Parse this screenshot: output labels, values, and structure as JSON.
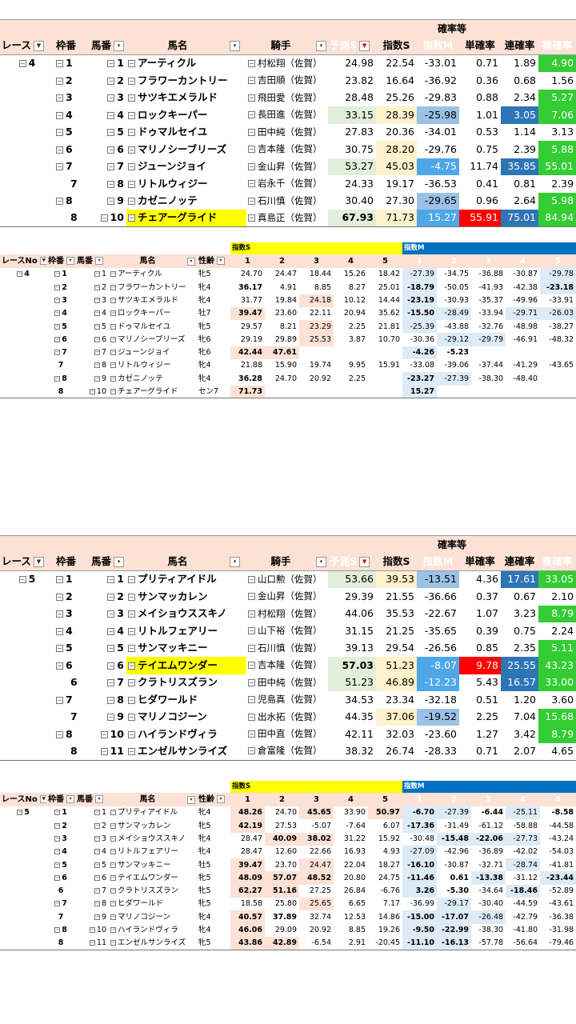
{
  "section_label": "確率等",
  "big_headers": {
    "race": "レース",
    "frame": "枠番",
    "horse_no": "馬番",
    "horse": "馬名",
    "jockey": "騎手",
    "pred": "予測S",
    "idxS": "指数S",
    "idxM": "指数M",
    "win": "単確率",
    "quin": "連確率",
    "place": "複確率"
  },
  "small_headers": {
    "groupS": "指数S",
    "groupM": "指数M",
    "race": "レースNo",
    "frame": "枠番",
    "horse_no": "馬番",
    "horse": "馬名",
    "sexage": "性齢",
    "cols": [
      "1",
      "2",
      "3",
      "4",
      "5"
    ]
  },
  "big1": [
    {
      "race": "4",
      "frame": "1",
      "no": "1",
      "name": "アーティクル",
      "jockey": "村松翔（佐賀）",
      "pred": "24.98",
      "s": "22.54",
      "m": "-33.01",
      "win": "0.71",
      "quin": "1.89",
      "place": "4.90"
    },
    {
      "race": "",
      "frame": "2",
      "no": "2",
      "name": "フラワーカントリー",
      "jockey": "吉田順（佐賀）",
      "pred": "23.82",
      "s": "16.64",
      "m": "-36.92",
      "win": "0.36",
      "quin": "0.68",
      "place": "1.56"
    },
    {
      "race": "",
      "frame": "3",
      "no": "3",
      "name": "サツキエメラルド",
      "jockey": "飛田愛（佐賀）",
      "pred": "28.48",
      "s": "25.26",
      "m": "-29.83",
      "win": "0.88",
      "quin": "2.34",
      "place": "5.27"
    },
    {
      "race": "",
      "frame": "4",
      "no": "4",
      "name": "ロックキーパー",
      "jockey": "長田進（佐賀）",
      "pred": "33.15",
      "s": "28.39",
      "m": "-25.98",
      "win": "1.01",
      "quin": "3.05",
      "place": "7.06"
    },
    {
      "race": "",
      "frame": "5",
      "no": "5",
      "name": "ドゥマルセイユ",
      "jockey": "田中純（佐賀）",
      "pred": "27.83",
      "s": "20.36",
      "m": "-34.01",
      "win": "0.53",
      "quin": "1.14",
      "place": "3.13"
    },
    {
      "race": "",
      "frame": "6",
      "no": "6",
      "name": "マリノシーブリーズ",
      "jockey": "吉本隆（佐賀）",
      "pred": "30.75",
      "s": "28.20",
      "m": "-29.76",
      "win": "0.75",
      "quin": "2.39",
      "place": "5.88"
    },
    {
      "race": "",
      "frame": "7",
      "no": "7",
      "name": "ジューンジョイ",
      "jockey": "金山昇（佐賀）",
      "pred": "53.27",
      "s": "45.03",
      "m": "-4.75",
      "win": "11.74",
      "quin": "35.85",
      "place": "55.01"
    },
    {
      "race": "",
      "frame": "7",
      "no": "8",
      "name": "リトルウィジー",
      "jockey": "岩永千（佐賀）",
      "pred": "24.33",
      "s": "19.17",
      "m": "-36.53",
      "win": "0.41",
      "quin": "0.81",
      "place": "2.39"
    },
    {
      "race": "",
      "frame": "8",
      "no": "9",
      "name": "カゼニノッテ",
      "jockey": "石川慎（佐賀）",
      "pred": "30.40",
      "s": "27.30",
      "m": "-29.65",
      "win": "0.96",
      "quin": "2.64",
      "place": "5.98"
    },
    {
      "race": "",
      "frame": "8",
      "no": "10",
      "name": "チェアーグライド",
      "jockey": "真島正（佐賀）",
      "pred": "67.93",
      "s": "71.73",
      "m": "15.27",
      "win": "55.91",
      "quin": "75.01",
      "place": "84.94"
    }
  ],
  "small1": [
    {
      "race": "4",
      "frame": "1",
      "no": "1",
      "name": "アーティクル",
      "sex": "牝5",
      "s": [
        "24.70",
        "24.47",
        "18.44",
        "15.26",
        "18.42"
      ],
      "m": [
        "-27.39",
        "-34.75",
        "-36.88",
        "-30.87",
        "-29.78"
      ]
    },
    {
      "race": "",
      "frame": "2",
      "no": "2",
      "name": "フラワーカントリー",
      "sex": "牝4",
      "s": [
        "36.17",
        "4.91",
        "8.85",
        "8.27",
        "25.01"
      ],
      "m": [
        "-18.79",
        "-50.05",
        "-41.93",
        "-42.38",
        "-23.18"
      ]
    },
    {
      "race": "",
      "frame": "3",
      "no": "3",
      "name": "サツキエメラルド",
      "sex": "牝4",
      "s": [
        "31.77",
        "19.84",
        "24.18",
        "10.12",
        "14.44"
      ],
      "m": [
        "-23.19",
        "-30.93",
        "-35.37",
        "-49.96",
        "-33.91"
      ]
    },
    {
      "race": "",
      "frame": "4",
      "no": "4",
      "name": "ロックキーパー",
      "sex": "牡7",
      "s": [
        "39.47",
        "23.60",
        "22.11",
        "20.94",
        "35.62"
      ],
      "m": [
        "-15.50",
        "-28.49",
        "-33.94",
        "-29.71",
        "-26.03"
      ]
    },
    {
      "race": "",
      "frame": "5",
      "no": "5",
      "name": "ドゥマルセイユ",
      "sex": "牝5",
      "s": [
        "29.57",
        "8.21",
        "23.29",
        "2.25",
        "21.81"
      ],
      "m": [
        "-25.39",
        "-43.88",
        "-32.76",
        "-48.98",
        "-38.27"
      ]
    },
    {
      "race": "",
      "frame": "6",
      "no": "6",
      "name": "マリノシーブリーズ",
      "sex": "牝6",
      "s": [
        "29.19",
        "29.89",
        "25.53",
        "3.87",
        "10.70"
      ],
      "m": [
        "-30.36",
        "-29.12",
        "-29.79",
        "-46.91",
        "-48.32"
      ]
    },
    {
      "race": "",
      "frame": "7",
      "no": "7",
      "name": "ジューンジョイ",
      "sex": "牝6",
      "s": [
        "42.44",
        "47.61",
        "",
        "",
        ""
      ],
      "m": [
        "-4.26",
        "-5.23",
        "",
        "",
        ""
      ]
    },
    {
      "race": "",
      "frame": "7",
      "no": "8",
      "name": "リトルウィジー",
      "sex": "牝4",
      "s": [
        "21.88",
        "15.90",
        "19.74",
        "9.95",
        "15.91"
      ],
      "m": [
        "-33.08",
        "-39.06",
        "-37.44",
        "-41.29",
        "-43.65"
      ]
    },
    {
      "race": "",
      "frame": "8",
      "no": "9",
      "name": "カゼニノッテ",
      "sex": "牝4",
      "s": [
        "36.28",
        "24.70",
        "20.92",
        "2.25",
        ""
      ],
      "m": [
        "-23.27",
        "-27.39",
        "-38.30",
        "-48.40",
        ""
      ]
    },
    {
      "race": "",
      "frame": "8",
      "no": "10",
      "name": "チェアーグライド",
      "sex": "セン7",
      "s": [
        "71.73",
        "",
        "",
        "",
        ""
      ],
      "m": [
        "15.27",
        "",
        "",
        "",
        ""
      ]
    }
  ],
  "big2": [
    {
      "race": "5",
      "frame": "1",
      "no": "1",
      "name": "プリティアイドル",
      "jockey": "山口勲（佐賀）",
      "pred": "53.66",
      "s": "39.53",
      "m": "-13.51",
      "win": "4.36",
      "quin": "17.61",
      "place": "33.05"
    },
    {
      "race": "",
      "frame": "2",
      "no": "2",
      "name": "サンマッカレン",
      "jockey": "金山昇（佐賀）",
      "pred": "29.39",
      "s": "21.55",
      "m": "-36.66",
      "win": "0.37",
      "quin": "0.67",
      "place": "2.10"
    },
    {
      "race": "",
      "frame": "3",
      "no": "3",
      "name": "メイショウススキノ",
      "jockey": "村松翔（佐賀）",
      "pred": "44.06",
      "s": "35.53",
      "m": "-22.67",
      "win": "1.07",
      "quin": "3.23",
      "place": "8.79"
    },
    {
      "race": "",
      "frame": "4",
      "no": "4",
      "name": "リトルフェアリー",
      "jockey": "山下裕（佐賀）",
      "pred": "31.15",
      "s": "21.25",
      "m": "-35.65",
      "win": "0.39",
      "quin": "0.75",
      "place": "2.24"
    },
    {
      "race": "",
      "frame": "5",
      "no": "5",
      "name": "サンマッキニー",
      "jockey": "石川慎（佐賀）",
      "pred": "39.13",
      "s": "29.54",
      "m": "-26.56",
      "win": "0.85",
      "quin": "2.35",
      "place": "5.11"
    },
    {
      "race": "",
      "frame": "6",
      "no": "6",
      "name": "テイエムワンダー",
      "jockey": "吉本隆（佐賀）",
      "pred": "57.03",
      "s": "51.23",
      "m": "-8.07",
      "win": "9.78",
      "quin": "25.55",
      "place": "43.23"
    },
    {
      "race": "",
      "frame": "6",
      "no": "7",
      "name": "クラトリスズラン",
      "jockey": "田中純（佐賀）",
      "pred": "51.23",
      "s": "46.89",
      "m": "-12.23",
      "win": "5.43",
      "quin": "16.57",
      "place": "33.00"
    },
    {
      "race": "",
      "frame": "7",
      "no": "8",
      "name": "ヒダワールド",
      "jockey": "児島真（佐賀）",
      "pred": "34.53",
      "s": "23.34",
      "m": "-32.18",
      "win": "0.51",
      "quin": "1.20",
      "place": "3.60"
    },
    {
      "race": "",
      "frame": "7",
      "no": "9",
      "name": "マリノコジーン",
      "jockey": "出水拓（佐賀）",
      "pred": "44.35",
      "s": "37.06",
      "m": "-19.52",
      "win": "2.25",
      "quin": "7.04",
      "place": "15.68"
    },
    {
      "race": "",
      "frame": "8",
      "no": "10",
      "name": "ハイランドヴィラ",
      "jockey": "田中直（佐賀）",
      "pred": "42.11",
      "s": "32.03",
      "m": "-23.60",
      "win": "1.27",
      "quin": "3.42",
      "place": "8.79"
    },
    {
      "race": "",
      "frame": "8",
      "no": "11",
      "name": "エンゼルサンライズ",
      "jockey": "倉富隆（佐賀）",
      "pred": "38.32",
      "s": "26.74",
      "m": "-28.33",
      "win": "0.71",
      "quin": "2.07",
      "place": "4.65"
    }
  ],
  "small2": [
    {
      "race": "5",
      "frame": "1",
      "no": "1",
      "name": "プリティアイドル",
      "sex": "牝4",
      "s": [
        "48.26",
        "24.70",
        "45.65",
        "33.90",
        "50.97"
      ],
      "m": [
        "-6.70",
        "-27.39",
        "-6.44",
        "-25.11",
        "-8.58"
      ]
    },
    {
      "race": "",
      "frame": "2",
      "no": "2",
      "name": "サンマッカレン",
      "sex": "牝5",
      "s": [
        "42.19",
        "27.53",
        "-5.07",
        "-7.64",
        "6.07"
      ],
      "m": [
        "-17.36",
        "-31.49",
        "-61.12",
        "-58.88",
        "-44.58"
      ]
    },
    {
      "race": "",
      "frame": "3",
      "no": "3",
      "name": "メイショウススキノ",
      "sex": "牝4",
      "s": [
        "28.47",
        "40.09",
        "38.02",
        "31.22",
        "15.92"
      ],
      "m": [
        "-30.48",
        "-15.48",
        "-22.06",
        "-27.73",
        "-43.24"
      ]
    },
    {
      "race": "",
      "frame": "4",
      "no": "4",
      "name": "リトルフェアリー",
      "sex": "牝4",
      "s": [
        "28.47",
        "12.60",
        "22.66",
        "16.93",
        "4.93"
      ],
      "m": [
        "-27.09",
        "-42.96",
        "-36.89",
        "-42.02",
        "-54.03"
      ]
    },
    {
      "race": "",
      "frame": "5",
      "no": "5",
      "name": "サンマッキニー",
      "sex": "牡5",
      "s": [
        "39.47",
        "23.70",
        "24.47",
        "22.04",
        "18.27"
      ],
      "m": [
        "-16.10",
        "-30.87",
        "-32.71",
        "-28.74",
        "-41.81"
      ]
    },
    {
      "race": "",
      "frame": "6",
      "no": "6",
      "name": "テイエムワンダー",
      "sex": "牝5",
      "s": [
        "48.09",
        "57.07",
        "48.52",
        "20.80",
        "24.75"
      ],
      "m": [
        "-11.46",
        "0.61",
        "-13.38",
        "-31.12",
        "-23.44"
      ]
    },
    {
      "race": "",
      "frame": "6",
      "no": "7",
      "name": "クラトリスズラン",
      "sex": "牝5",
      "s": [
        "62.27",
        "51.16",
        "27.25",
        "26.84",
        "-6.76"
      ],
      "m": [
        "3.26",
        "-5.30",
        "-34.64",
        "-18.46",
        "-52.89"
      ]
    },
    {
      "race": "",
      "frame": "7",
      "no": "8",
      "name": "ヒダワールド",
      "sex": "牝5",
      "s": [
        "18.58",
        "25.80",
        "25.65",
        "6.65",
        "7.17"
      ],
      "m": [
        "-36.99",
        "-29.17",
        "-30.40",
        "-44.59",
        "-43.61"
      ]
    },
    {
      "race": "",
      "frame": "7",
      "no": "9",
      "name": "マリノコジーン",
      "sex": "牝4",
      "s": [
        "40.57",
        "37.89",
        "32.74",
        "12.53",
        "14.86"
      ],
      "m": [
        "-15.00",
        "-17.07",
        "-26.48",
        "-42.79",
        "-36.38"
      ]
    },
    {
      "race": "",
      "frame": "8",
      "no": "10",
      "name": "ハイランドヴィラ",
      "sex": "牝4",
      "s": [
        "46.06",
        "29.09",
        "20.92",
        "8.85",
        "19.26"
      ],
      "m": [
        "-9.50",
        "-22.99",
        "-38.30",
        "-41.80",
        "-31.98"
      ]
    },
    {
      "race": "",
      "frame": "8",
      "no": "11",
      "name": "エンゼルサンライズ",
      "sex": "牝5",
      "s": [
        "43.86",
        "42.89",
        "-6.54",
        "2.91",
        "-20.45"
      ],
      "m": [
        "-11.10",
        "-16.13",
        "-57.78",
        "-56.64",
        "-79.46"
      ]
    }
  ],
  "highlights": {
    "big1": {
      "selected": 9,
      "pred": {
        "3": "ltgreen",
        "6": "ltgreen",
        "9": "ltgreen"
      },
      "s": {
        "3": "ltyel",
        "5": "ltyel",
        "6": "ltyel",
        "9": "ltyel"
      },
      "m": {
        "3": "blue2",
        "6": "ltblue2",
        "8": "blue2",
        "9": "ltblue2"
      },
      "win": {
        "9": "red"
      },
      "quin": {
        "3": "dkblue",
        "6": "dkblue",
        "9": "dkblue"
      },
      "place": {
        "0": "green",
        "2": "green",
        "3": "green",
        "5": "green",
        "6": "green",
        "8": "green",
        "9": "green"
      }
    },
    "big2": {
      "selected": 5,
      "pred": {
        "0": "ltgreen",
        "5": "ltgreen",
        "6": "ltgreen"
      },
      "s": {
        "0": "ltyel",
        "5": "ltyel",
        "6": "ltyel",
        "8": "ltyel"
      },
      "m": {
        "0": "blue2",
        "5": "ltblue2",
        "6": "ltblue2",
        "8": "blue2"
      },
      "win": {
        "5": "red"
      },
      "quin": {
        "0": "dkblue",
        "5": "dkblue",
        "6": "dkblue"
      },
      "place": {
        "0": "green",
        "2": "green",
        "4": "green",
        "5": "green",
        "6": "green",
        "8": "green",
        "9": "green"
      }
    }
  }
}
